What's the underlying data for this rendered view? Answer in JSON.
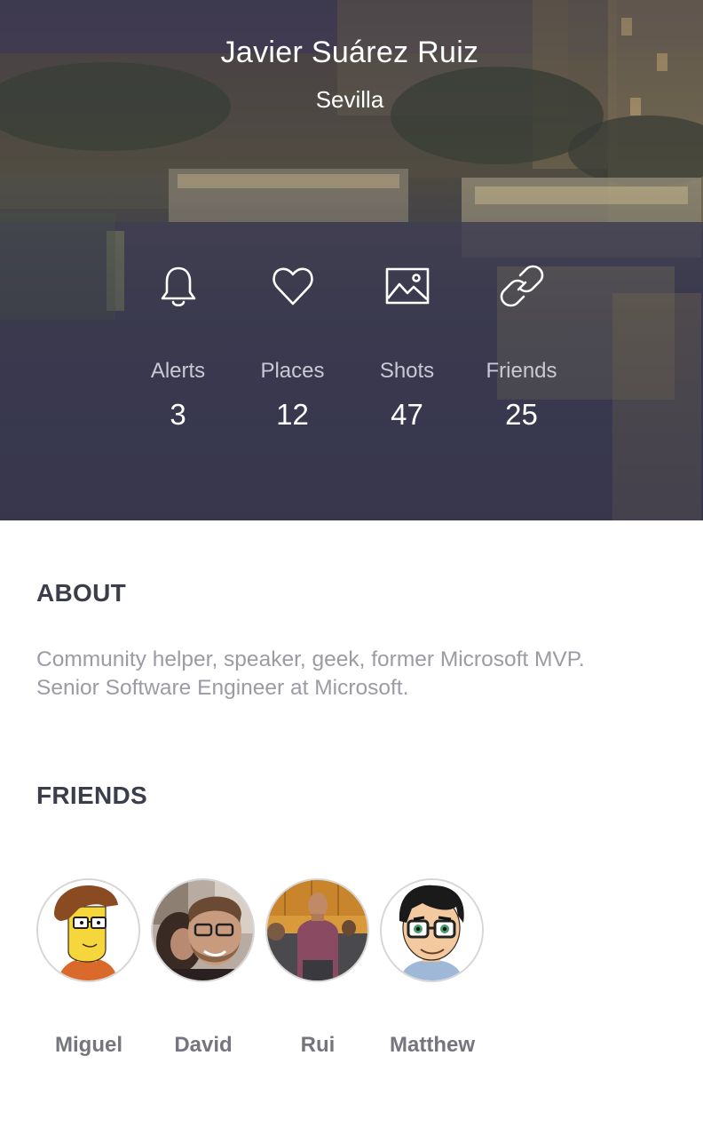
{
  "profile": {
    "name": "Javier Suárez Ruiz",
    "city": "Sevilla"
  },
  "stats": [
    {
      "icon": "bell-icon",
      "label": "Alerts",
      "value": "3"
    },
    {
      "icon": "heart-icon",
      "label": "Places",
      "value": "12"
    },
    {
      "icon": "image-icon",
      "label": "Shots",
      "value": "47"
    },
    {
      "icon": "link-icon",
      "label": "Friends",
      "value": "25"
    }
  ],
  "about": {
    "title": "ABOUT",
    "lines": [
      "Community helper, speaker, geek, former Microsoft MVP.",
      "Senior Software Engineer at Microsoft."
    ]
  },
  "friends": {
    "title": "FRIENDS",
    "items": [
      {
        "name": "Miguel"
      },
      {
        "name": "David"
      },
      {
        "name": "Rui"
      },
      {
        "name": "Matthew"
      }
    ]
  },
  "colors": {
    "header_overlay": "#3a3b4f",
    "section_title": "#3b3e4a",
    "body_text": "#9b9ba3",
    "friend_name": "#75757d"
  }
}
